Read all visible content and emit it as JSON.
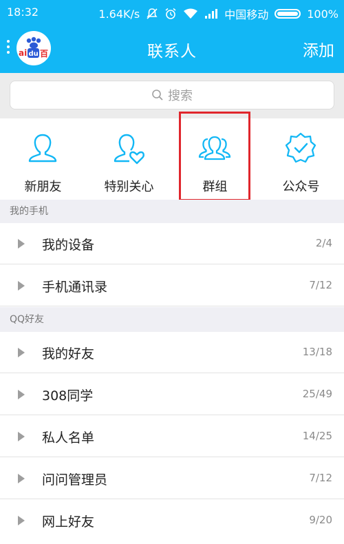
{
  "status_bar": {
    "time": "18:32",
    "network_speed": "1.64K/s",
    "carrier": "中国移动",
    "battery": "100%",
    "icons": [
      "mute-icon",
      "alarm-icon",
      "wifi-icon",
      "signal-icon",
      "battery-icon"
    ]
  },
  "header": {
    "title": "联系人",
    "add_label": "添加",
    "avatar_text": "ai du 百"
  },
  "search": {
    "placeholder": "搜索"
  },
  "quick_actions": [
    {
      "label": "新朋友",
      "icon": "person-icon"
    },
    {
      "label": "特别关心",
      "icon": "person-heart-icon"
    },
    {
      "label": "群组",
      "icon": "group-icon",
      "highlighted": true
    },
    {
      "label": "公众号",
      "icon": "verified-badge-icon"
    }
  ],
  "sections": [
    {
      "title": "我的手机",
      "rows": [
        {
          "name": "我的设备",
          "count": "2/4"
        },
        {
          "name": "手机通讯录",
          "count": "7/12"
        }
      ]
    },
    {
      "title": "QQ好友",
      "rows": [
        {
          "name": "我的好友",
          "count": "13/18"
        },
        {
          "name": "308同学",
          "count": "25/49"
        },
        {
          "name": "私人名单",
          "count": "14/25"
        },
        {
          "name": "问问管理员",
          "count": "7/12"
        },
        {
          "name": "网上好友",
          "count": "9/20"
        }
      ]
    }
  ],
  "colors": {
    "accent": "#12b7f5",
    "highlight_border": "#e0262c",
    "section_bg": "#efeff4"
  }
}
